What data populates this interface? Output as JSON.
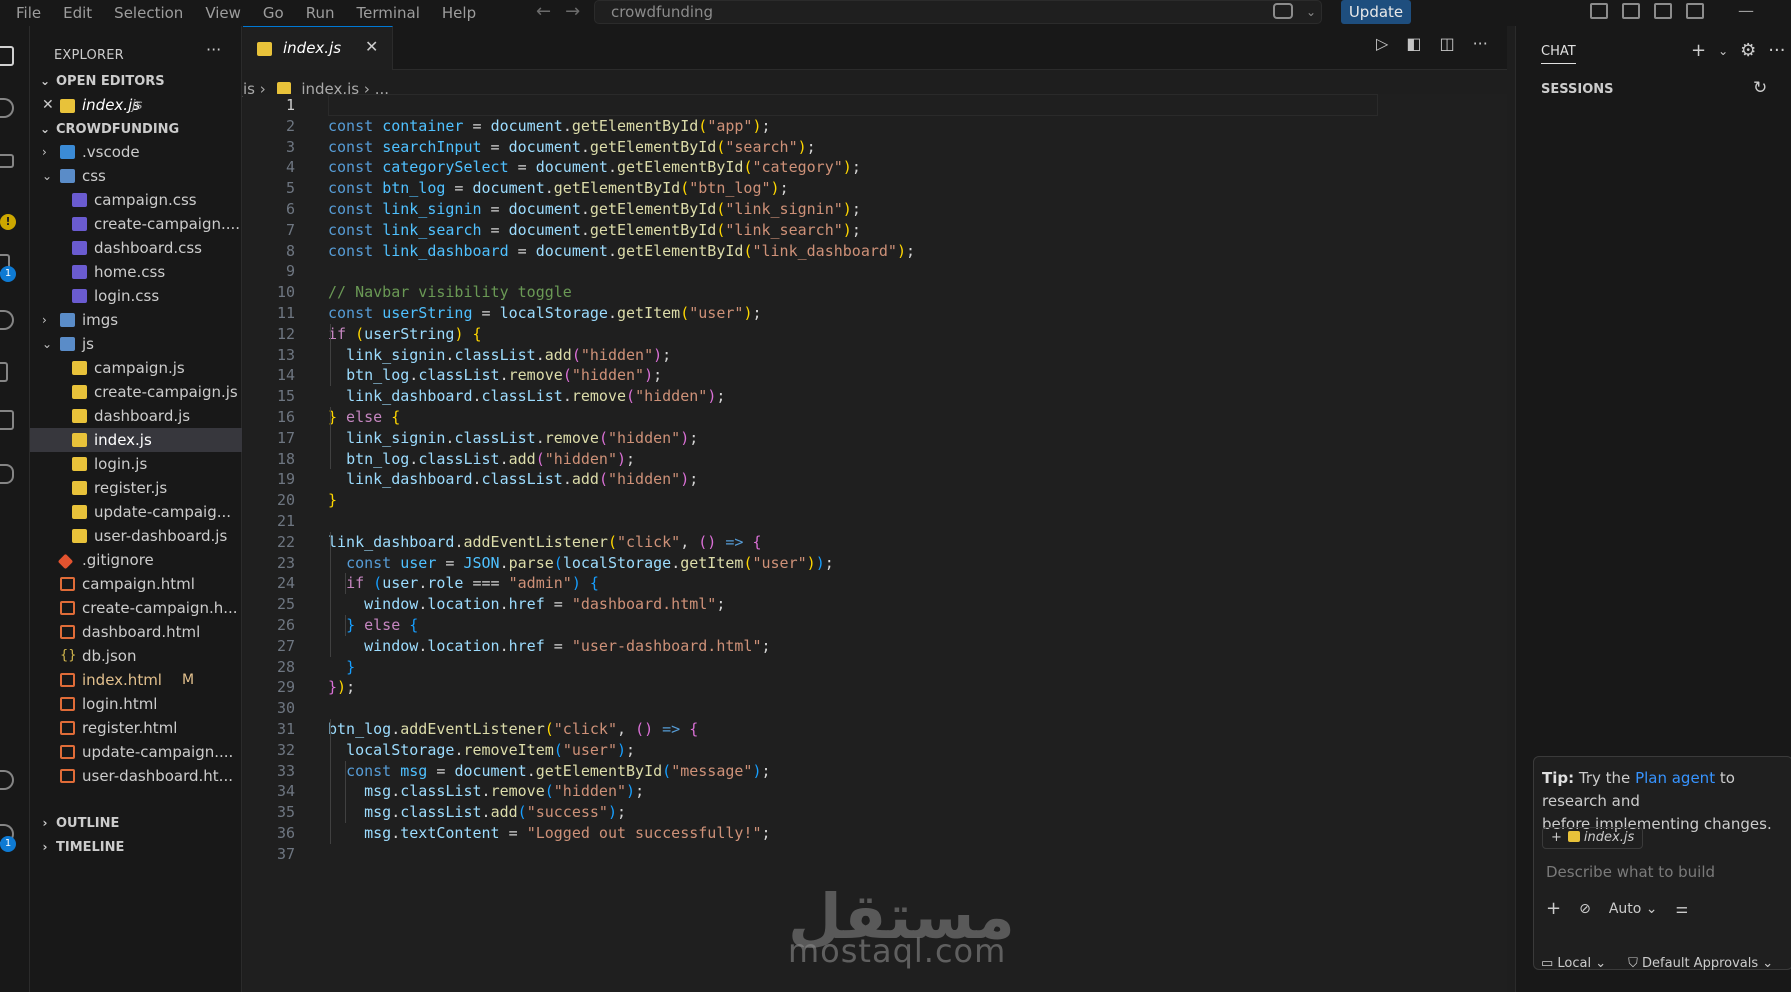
{
  "titlebar": {
    "menu": [
      "File",
      "Edit",
      "Selection",
      "View",
      "Go",
      "Run",
      "Terminal",
      "Help"
    ],
    "search_text": "crowdfunding",
    "update_label": "Update"
  },
  "explorer": {
    "title": "EXPLORER",
    "open_editors_header": "OPEN EDITORS",
    "open_editor": {
      "name": "index.js",
      "folder": "js"
    },
    "project_header": "CROWDFUNDING",
    "tree": [
      {
        "label": ".vscode",
        "type": "folder",
        "depth": 0,
        "expanded": false
      },
      {
        "label": "css",
        "type": "folder",
        "depth": 0,
        "expanded": true
      },
      {
        "label": "campaign.css",
        "type": "css",
        "depth": 1
      },
      {
        "label": "create-campaign....",
        "type": "css",
        "depth": 1
      },
      {
        "label": "dashboard.css",
        "type": "css",
        "depth": 1
      },
      {
        "label": "home.css",
        "type": "css",
        "depth": 1
      },
      {
        "label": "login.css",
        "type": "css",
        "depth": 1
      },
      {
        "label": "imgs",
        "type": "folder",
        "depth": 0,
        "expanded": false
      },
      {
        "label": "js",
        "type": "folder",
        "depth": 0,
        "expanded": true
      },
      {
        "label": "campaign.js",
        "type": "js",
        "depth": 1
      },
      {
        "label": "create-campaign.js",
        "type": "js",
        "depth": 1
      },
      {
        "label": "dashboard.js",
        "type": "js",
        "depth": 1
      },
      {
        "label": "index.js",
        "type": "js",
        "depth": 1,
        "selected": true
      },
      {
        "label": "login.js",
        "type": "js",
        "depth": 1
      },
      {
        "label": "register.js",
        "type": "js",
        "depth": 1
      },
      {
        "label": "update-campaig...",
        "type": "js",
        "depth": 1
      },
      {
        "label": "user-dashboard.js",
        "type": "js",
        "depth": 1
      },
      {
        "label": ".gitignore",
        "type": "git",
        "depth": 0
      },
      {
        "label": "campaign.html",
        "type": "html",
        "depth": 0
      },
      {
        "label": "create-campaign.h...",
        "type": "html",
        "depth": 0
      },
      {
        "label": "dashboard.html",
        "type": "html",
        "depth": 0
      },
      {
        "label": "db.json",
        "type": "json",
        "depth": 0
      },
      {
        "label": "index.html",
        "type": "html",
        "depth": 0,
        "modified": true,
        "badge": "M"
      },
      {
        "label": "login.html",
        "type": "html",
        "depth": 0
      },
      {
        "label": "register.html",
        "type": "html",
        "depth": 0
      },
      {
        "label": "update-campaign....",
        "type": "html",
        "depth": 0
      },
      {
        "label": "user-dashboard.ht...",
        "type": "html",
        "depth": 0
      }
    ],
    "outline_header": "OUTLINE",
    "timeline_header": "TIMELINE",
    "activity_badges": {
      "source_control": "1",
      "accounts": "1"
    }
  },
  "editor": {
    "tab_label": "index.js",
    "breadcrumb": [
      "js",
      "index.js",
      "..."
    ],
    "lines": [
      [],
      [
        [
          "kw",
          "const "
        ],
        [
          "cst",
          "container"
        ],
        [
          "op",
          " = "
        ],
        [
          "var",
          "document"
        ],
        [
          "op",
          "."
        ],
        [
          "fn",
          "getElementById"
        ],
        [
          "p1",
          "("
        ],
        [
          "str",
          "\"app\""
        ],
        [
          "p1",
          ")"
        ],
        [
          "op",
          ";"
        ]
      ],
      [
        [
          "kw",
          "const "
        ],
        [
          "cst",
          "searchInput"
        ],
        [
          "op",
          " = "
        ],
        [
          "var",
          "document"
        ],
        [
          "op",
          "."
        ],
        [
          "fn",
          "getElementById"
        ],
        [
          "p1",
          "("
        ],
        [
          "str",
          "\"search\""
        ],
        [
          "p1",
          ")"
        ],
        [
          "op",
          ";"
        ]
      ],
      [
        [
          "kw",
          "const "
        ],
        [
          "cst",
          "categorySelect"
        ],
        [
          "op",
          " = "
        ],
        [
          "var",
          "document"
        ],
        [
          "op",
          "."
        ],
        [
          "fn",
          "getElementById"
        ],
        [
          "p1",
          "("
        ],
        [
          "str",
          "\"category\""
        ],
        [
          "p1",
          ")"
        ],
        [
          "op",
          ";"
        ]
      ],
      [
        [
          "kw",
          "const "
        ],
        [
          "cst",
          "btn_log"
        ],
        [
          "op",
          " = "
        ],
        [
          "var",
          "document"
        ],
        [
          "op",
          "."
        ],
        [
          "fn",
          "getElementById"
        ],
        [
          "p1",
          "("
        ],
        [
          "str",
          "\"btn_log\""
        ],
        [
          "p1",
          ")"
        ],
        [
          "op",
          ";"
        ]
      ],
      [
        [
          "kw",
          "const "
        ],
        [
          "cst",
          "link_signin"
        ],
        [
          "op",
          " = "
        ],
        [
          "var",
          "document"
        ],
        [
          "op",
          "."
        ],
        [
          "fn",
          "getElementById"
        ],
        [
          "p1",
          "("
        ],
        [
          "str",
          "\"link_signin\""
        ],
        [
          "p1",
          ")"
        ],
        [
          "op",
          ";"
        ]
      ],
      [
        [
          "kw",
          "const "
        ],
        [
          "cst",
          "link_search"
        ],
        [
          "op",
          " = "
        ],
        [
          "var",
          "document"
        ],
        [
          "op",
          "."
        ],
        [
          "fn",
          "getElementById"
        ],
        [
          "p1",
          "("
        ],
        [
          "str",
          "\"link_search\""
        ],
        [
          "p1",
          ")"
        ],
        [
          "op",
          ";"
        ]
      ],
      [
        [
          "kw",
          "const "
        ],
        [
          "cst",
          "link_dashboard"
        ],
        [
          "op",
          " = "
        ],
        [
          "var",
          "document"
        ],
        [
          "op",
          "."
        ],
        [
          "fn",
          "getElementById"
        ],
        [
          "p1",
          "("
        ],
        [
          "str",
          "\"link_dashboard\""
        ],
        [
          "p1",
          ")"
        ],
        [
          "op",
          ";"
        ]
      ],
      [],
      [
        [
          "cm",
          "// Navbar visibility toggle"
        ]
      ],
      [
        [
          "kw",
          "const "
        ],
        [
          "cst",
          "userString"
        ],
        [
          "op",
          " = "
        ],
        [
          "var",
          "localStorage"
        ],
        [
          "op",
          "."
        ],
        [
          "fn",
          "getItem"
        ],
        [
          "p1",
          "("
        ],
        [
          "str",
          "\"user\""
        ],
        [
          "p1",
          ")"
        ],
        [
          "op",
          ";"
        ]
      ],
      [
        [
          "ctrl",
          "if "
        ],
        [
          "p1",
          "("
        ],
        [
          "var",
          "userString"
        ],
        [
          "p1",
          ")"
        ],
        [
          "op",
          " "
        ],
        [
          "p1",
          "{"
        ]
      ],
      [
        [
          "op",
          "  "
        ],
        [
          "var",
          "link_signin"
        ],
        [
          "op",
          "."
        ],
        [
          "var",
          "classList"
        ],
        [
          "op",
          "."
        ],
        [
          "fn",
          "add"
        ],
        [
          "p2",
          "("
        ],
        [
          "str",
          "\"hidden\""
        ],
        [
          "p2",
          ")"
        ],
        [
          "op",
          ";"
        ]
      ],
      [
        [
          "op",
          "  "
        ],
        [
          "var",
          "btn_log"
        ],
        [
          "op",
          "."
        ],
        [
          "var",
          "classList"
        ],
        [
          "op",
          "."
        ],
        [
          "fn",
          "remove"
        ],
        [
          "p2",
          "("
        ],
        [
          "str",
          "\"hidden\""
        ],
        [
          "p2",
          ")"
        ],
        [
          "op",
          ";"
        ]
      ],
      [
        [
          "op",
          "  "
        ],
        [
          "var",
          "link_dashboard"
        ],
        [
          "op",
          "."
        ],
        [
          "var",
          "classList"
        ],
        [
          "op",
          "."
        ],
        [
          "fn",
          "remove"
        ],
        [
          "p2",
          "("
        ],
        [
          "str",
          "\"hidden\""
        ],
        [
          "p2",
          ")"
        ],
        [
          "op",
          ";"
        ]
      ],
      [
        [
          "p1",
          "}"
        ],
        [
          "ctrl",
          " else "
        ],
        [
          "p1",
          "{"
        ]
      ],
      [
        [
          "op",
          "  "
        ],
        [
          "var",
          "link_signin"
        ],
        [
          "op",
          "."
        ],
        [
          "var",
          "classList"
        ],
        [
          "op",
          "."
        ],
        [
          "fn",
          "remove"
        ],
        [
          "p2",
          "("
        ],
        [
          "str",
          "\"hidden\""
        ],
        [
          "p2",
          ")"
        ],
        [
          "op",
          ";"
        ]
      ],
      [
        [
          "op",
          "  "
        ],
        [
          "var",
          "btn_log"
        ],
        [
          "op",
          "."
        ],
        [
          "var",
          "classList"
        ],
        [
          "op",
          "."
        ],
        [
          "fn",
          "add"
        ],
        [
          "p2",
          "("
        ],
        [
          "str",
          "\"hidden\""
        ],
        [
          "p2",
          ")"
        ],
        [
          "op",
          ";"
        ]
      ],
      [
        [
          "op",
          "  "
        ],
        [
          "var",
          "link_dashboard"
        ],
        [
          "op",
          "."
        ],
        [
          "var",
          "classList"
        ],
        [
          "op",
          "."
        ],
        [
          "fn",
          "add"
        ],
        [
          "p2",
          "("
        ],
        [
          "str",
          "\"hidden\""
        ],
        [
          "p2",
          ")"
        ],
        [
          "op",
          ";"
        ]
      ],
      [
        [
          "p1",
          "}"
        ]
      ],
      [],
      [
        [
          "var",
          "link_dashboard"
        ],
        [
          "op",
          "."
        ],
        [
          "fn",
          "addEventListener"
        ],
        [
          "p1",
          "("
        ],
        [
          "str",
          "\"click\""
        ],
        [
          "op",
          ", "
        ],
        [
          "p2",
          "()"
        ],
        [
          "kw",
          " => "
        ],
        [
          "p2",
          "{"
        ]
      ],
      [
        [
          "op",
          "  "
        ],
        [
          "kw",
          "const "
        ],
        [
          "cst",
          "user"
        ],
        [
          "op",
          " = "
        ],
        [
          "cst",
          "JSON"
        ],
        [
          "op",
          "."
        ],
        [
          "fn",
          "parse"
        ],
        [
          "p3",
          "("
        ],
        [
          "var",
          "localStorage"
        ],
        [
          "op",
          "."
        ],
        [
          "fn",
          "getItem"
        ],
        [
          "p1",
          "("
        ],
        [
          "str",
          "\"user\""
        ],
        [
          "p1",
          ")"
        ],
        [
          "p3",
          ")"
        ],
        [
          "op",
          ";"
        ]
      ],
      [
        [
          "op",
          "  "
        ],
        [
          "ctrl",
          "if "
        ],
        [
          "p3",
          "("
        ],
        [
          "var",
          "user"
        ],
        [
          "op",
          "."
        ],
        [
          "var",
          "role"
        ],
        [
          "op",
          " === "
        ],
        [
          "str",
          "\"admin\""
        ],
        [
          "p3",
          ")"
        ],
        [
          "op",
          " "
        ],
        [
          "p3",
          "{"
        ]
      ],
      [
        [
          "op",
          "    "
        ],
        [
          "var",
          "window"
        ],
        [
          "op",
          "."
        ],
        [
          "var",
          "location"
        ],
        [
          "op",
          "."
        ],
        [
          "var",
          "href"
        ],
        [
          "op",
          " = "
        ],
        [
          "str",
          "\"dashboard.html\""
        ],
        [
          "op",
          ";"
        ]
      ],
      [
        [
          "op",
          "  "
        ],
        [
          "p3",
          "}"
        ],
        [
          "ctrl",
          " else "
        ],
        [
          "p3",
          "{"
        ]
      ],
      [
        [
          "op",
          "    "
        ],
        [
          "var",
          "window"
        ],
        [
          "op",
          "."
        ],
        [
          "var",
          "location"
        ],
        [
          "op",
          "."
        ],
        [
          "var",
          "href"
        ],
        [
          "op",
          " = "
        ],
        [
          "str",
          "\"user-dashboard.html\""
        ],
        [
          "op",
          ";"
        ]
      ],
      [
        [
          "op",
          "  "
        ],
        [
          "p3",
          "}"
        ]
      ],
      [
        [
          "p2",
          "}"
        ],
        [
          "p1",
          ")"
        ],
        [
          "op",
          ";"
        ]
      ],
      [],
      [
        [
          "var",
          "btn_log"
        ],
        [
          "op",
          "."
        ],
        [
          "fn",
          "addEventListener"
        ],
        [
          "p1",
          "("
        ],
        [
          "str",
          "\"click\""
        ],
        [
          "op",
          ", "
        ],
        [
          "p2",
          "()"
        ],
        [
          "kw",
          " => "
        ],
        [
          "p2",
          "{"
        ]
      ],
      [
        [
          "op",
          "  "
        ],
        [
          "var",
          "localStorage"
        ],
        [
          "op",
          "."
        ],
        [
          "fn",
          "removeItem"
        ],
        [
          "p3",
          "("
        ],
        [
          "str",
          "\"user\""
        ],
        [
          "p3",
          ")"
        ],
        [
          "op",
          ";"
        ]
      ],
      [
        [
          "op",
          "  "
        ],
        [
          "kw",
          "const "
        ],
        [
          "cst",
          "msg"
        ],
        [
          "op",
          " = "
        ],
        [
          "var",
          "document"
        ],
        [
          "op",
          "."
        ],
        [
          "fn",
          "getElementById"
        ],
        [
          "p3",
          "("
        ],
        [
          "str",
          "\"message\""
        ],
        [
          "p3",
          ")"
        ],
        [
          "op",
          ";"
        ]
      ],
      [
        [
          "op",
          "    "
        ],
        [
          "var",
          "msg"
        ],
        [
          "op",
          "."
        ],
        [
          "var",
          "classList"
        ],
        [
          "op",
          "."
        ],
        [
          "fn",
          "remove"
        ],
        [
          "p3",
          "("
        ],
        [
          "str",
          "\"hidden\""
        ],
        [
          "p3",
          ")"
        ],
        [
          "op",
          ";"
        ]
      ],
      [
        [
          "op",
          "    "
        ],
        [
          "var",
          "msg"
        ],
        [
          "op",
          "."
        ],
        [
          "var",
          "classList"
        ],
        [
          "op",
          "."
        ],
        [
          "fn",
          "add"
        ],
        [
          "p3",
          "("
        ],
        [
          "str",
          "\"success\""
        ],
        [
          "p3",
          ")"
        ],
        [
          "op",
          ";"
        ]
      ],
      [
        [
          "op",
          "    "
        ],
        [
          "var",
          "msg"
        ],
        [
          "op",
          "."
        ],
        [
          "var",
          "textContent"
        ],
        [
          "op",
          " = "
        ],
        [
          "str",
          "\"Logged out successfully!\""
        ],
        [
          "op",
          ";"
        ]
      ],
      []
    ]
  },
  "chat": {
    "title": "CHAT",
    "sessions_header": "SESSIONS",
    "tip_bold": "Tip:",
    "tip_pre": "Try the",
    "tip_link": "Plan agent",
    "tip_post": "to research and",
    "tip_line2": "before implementing changes.",
    "context_chip": "index.js",
    "input_placeholder": "Describe what to build",
    "mode_label": "Auto",
    "footer_local": "Local",
    "footer_approvals": "Default Approvals"
  },
  "watermark": {
    "arabic": "مستقل",
    "latin": "mostaql.com"
  }
}
